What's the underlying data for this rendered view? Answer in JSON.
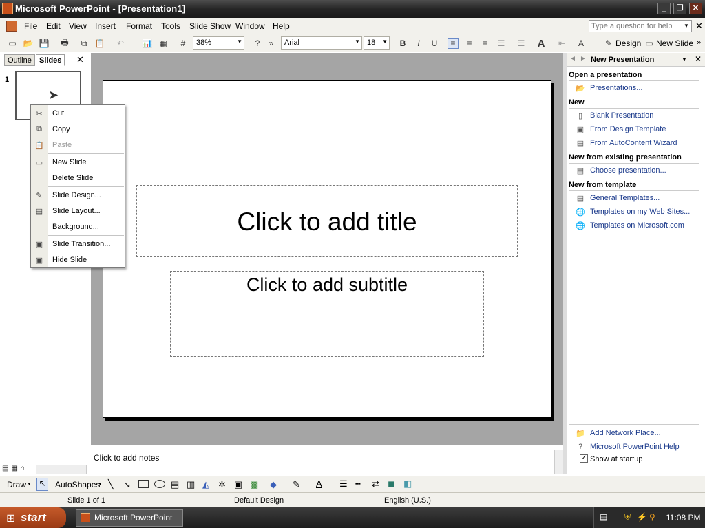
{
  "window": {
    "title": "Microsoft PowerPoint - [Presentation1]"
  },
  "menus": [
    "File",
    "Edit",
    "View",
    "Insert",
    "Format",
    "Tools",
    "Slide Show",
    "Window",
    "Help"
  ],
  "help": {
    "placeholder": "Type a question for help"
  },
  "toolbar": {
    "zoom": "38%",
    "font": "Arial",
    "size": "18",
    "design_label": "Design",
    "new_slide_label": "New Slide"
  },
  "leftpane": {
    "tab_outline": "Outline",
    "tab_slides": "Slides",
    "slide_number": "1"
  },
  "slide": {
    "title_placeholder": "Click to add title",
    "subtitle_placeholder": "Click to add subtitle"
  },
  "notes": {
    "placeholder": "Click to add notes"
  },
  "context_menu": {
    "items": [
      "Cut",
      "Copy",
      "Paste",
      "New Slide",
      "Delete Slide",
      "Slide Design...",
      "Slide Layout...",
      "Background...",
      "Slide Transition...",
      "Hide Slide"
    ],
    "disabled": [
      "Paste"
    ]
  },
  "taskpane": {
    "title": "New Presentation",
    "sections": {
      "open": "Open a presentation",
      "new": "New",
      "existing": "New from existing presentation",
      "template": "New from template"
    },
    "links": {
      "presentations": "Presentations...",
      "blank": "Blank Presentation",
      "design_template": "From Design Template",
      "autocontent": "From AutoContent Wizard",
      "choose": "Choose presentation...",
      "general": "General Templates...",
      "websites": "Templates on my Web Sites...",
      "microsoft": "Templates on Microsoft.com",
      "network": "Add Network Place...",
      "help": "Microsoft PowerPoint Help"
    },
    "show_at_startup": "Show at startup",
    "show_at_startup_checked": true
  },
  "drawbar": {
    "draw": "Draw",
    "autoshapes": "AutoShapes"
  },
  "status": {
    "slide": "Slide 1 of 1",
    "design": "Default Design",
    "language": "English (U.S.)"
  },
  "taskbar": {
    "start": "start",
    "task": "Microsoft PowerPoint ...",
    "time": "11:08 PM"
  }
}
